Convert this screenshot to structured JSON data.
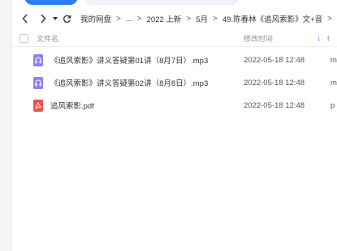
{
  "nav": {
    "breadcrumbs": [
      "我的网盘",
      "...",
      "2022 上新",
      "5月",
      "49.陈春林《追风索影》文+音"
    ],
    "separator": ">",
    "trailing_arrow": ">"
  },
  "table": {
    "header": {
      "name": "文件名",
      "modified": "修改时间",
      "extra": "f"
    },
    "rows": [
      {
        "icon": "audio-file-icon",
        "name": "《追风索影》讲义答疑第01讲（8月7日）.mp3",
        "modified": "2022-05-18 12:48",
        "extra": "m"
      },
      {
        "icon": "audio-file-icon",
        "name": "《追风索影》讲义答疑第02讲（8月8日）.mp3",
        "modified": "2022-05-18 12:48",
        "extra": "m"
      },
      {
        "icon": "pdf-file-icon",
        "name": "追风索影.pdf",
        "modified": "2022-05-18 12:48",
        "extra": "p"
      }
    ]
  },
  "colors": {
    "accent": "#2e7cf6",
    "audio_icon": "#8c82f2",
    "pdf_icon": "#f0504e"
  }
}
